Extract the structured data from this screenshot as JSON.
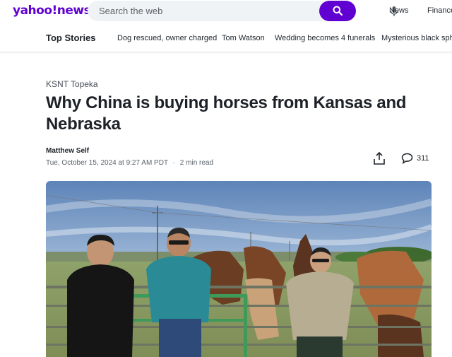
{
  "header": {
    "logo": "yahoo!news",
    "search_placeholder": "Search the web",
    "nav": [
      "News",
      "Finance"
    ]
  },
  "subnav": {
    "title": "Top Stories",
    "links": [
      "Dog rescued, owner charged",
      "Tom Watson",
      "Wedding becomes 4 funerals",
      "Mysterious black sphe"
    ]
  },
  "article": {
    "provider": "KSNT Topeka",
    "headline": "Why China is buying horses from Kansas and Nebraska",
    "author": "Matthew Self",
    "date": "Tue, October 15, 2024 at 9:27 AM PDT",
    "separator": "·",
    "read_time": "2 min read",
    "comment_count": "311"
  },
  "colors": {
    "brand": "#6001d2",
    "text": "#1d2228",
    "muted": "#5b636a"
  },
  "icons": [
    "search-icon",
    "microphone-icon",
    "share-icon",
    "comment-icon"
  ]
}
